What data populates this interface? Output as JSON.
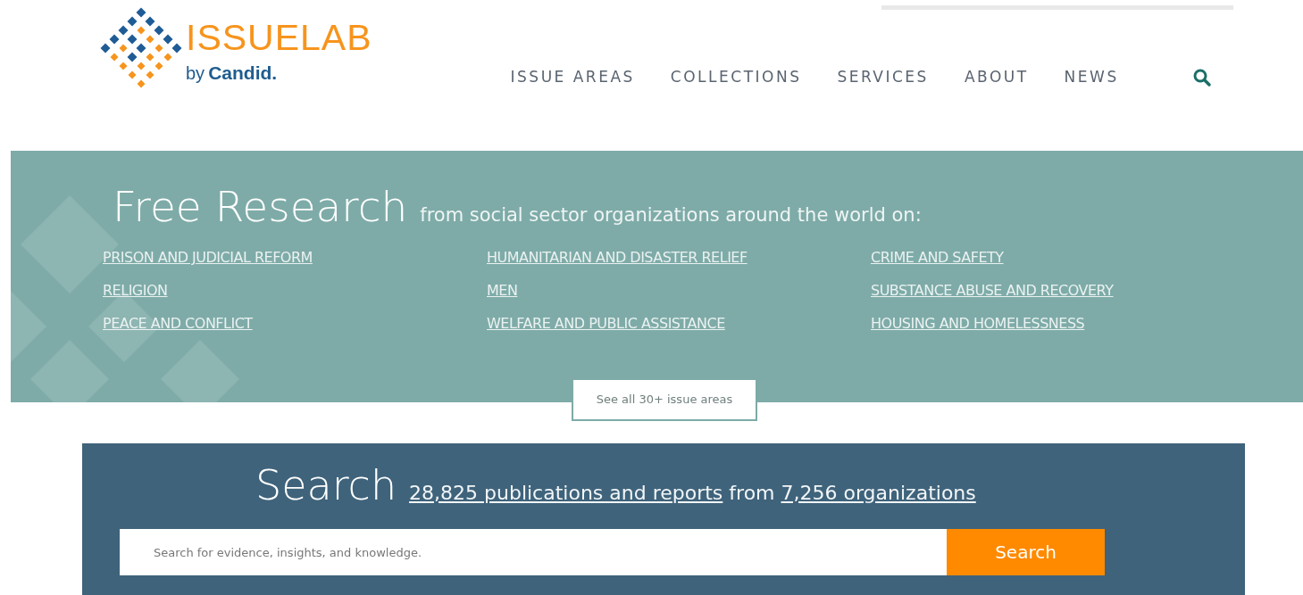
{
  "logo": {
    "name": "ISSUELAB",
    "byline_prefix": "by",
    "byline_brand": "Candid."
  },
  "nav": {
    "items": [
      {
        "label": "ISSUE AREAS"
      },
      {
        "label": "COLLECTIONS"
      },
      {
        "label": "SERVICES"
      },
      {
        "label": "ABOUT"
      },
      {
        "label": "NEWS"
      }
    ]
  },
  "hero": {
    "title": "Free Research",
    "subtitle": "from social sector organizations around the world on:",
    "issue_areas": [
      [
        "PRISON AND JUDICIAL REFORM",
        "RELIGION",
        "PEACE AND CONFLICT"
      ],
      [
        "HUMANITARIAN AND DISASTER RELIEF",
        "MEN",
        "WELFARE AND PUBLIC ASSISTANCE"
      ],
      [
        "CRIME AND SAFETY",
        "SUBSTANCE ABUSE AND RECOVERY",
        "HOUSING AND HOMELESSNESS"
      ]
    ],
    "see_all_button": "See all 30+ issue areas"
  },
  "search": {
    "title": "Search",
    "publications_link": "28,825 publications and reports",
    "connector": "from",
    "organizations_link": "7,256 organizations",
    "placeholder": "Search for evidence, insights, and knowledge.",
    "button": "Search"
  }
}
